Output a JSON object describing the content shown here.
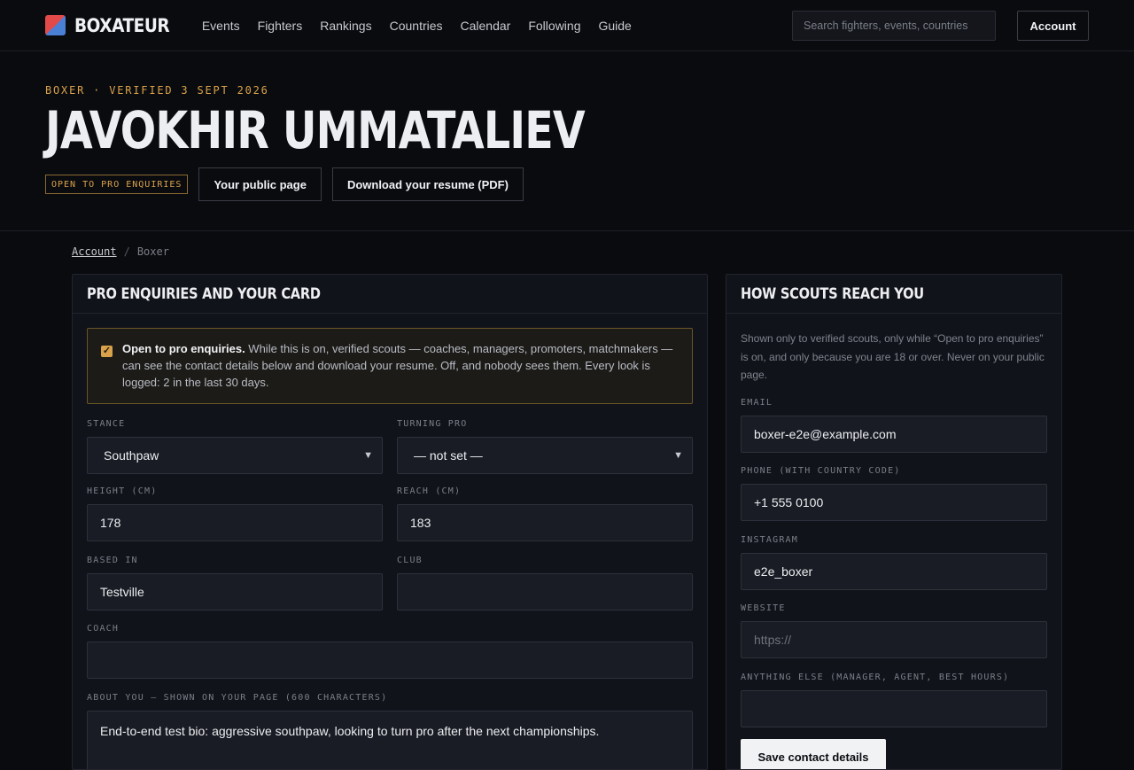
{
  "nav": {
    "brand": "BOXATEUR",
    "links": [
      "Events",
      "Fighters",
      "Rankings",
      "Countries",
      "Calendar",
      "Following",
      "Guide"
    ],
    "search_placeholder": "Search fighters, events, countries",
    "account_label": "Account"
  },
  "hero": {
    "eyebrow": "BOXER · VERIFIED 3 SEPT 2026",
    "name": "JAVOKHIR UMMATALIEV",
    "badge": "OPEN TO PRO ENQUIRIES",
    "public_page_label": "Your public page",
    "resume_label": "Download your resume (PDF)"
  },
  "breadcrumb": {
    "parent": "Account",
    "separator": "/",
    "current": "Boxer"
  },
  "left_panel": {
    "title": "PRO ENQUIRIES AND YOUR CARD",
    "notice": {
      "checked": true,
      "strong": "Open to pro enquiries.",
      "text": " While this is on, verified scouts — coaches, managers, promoters, matchmakers — can see the contact details below and download your resume. Off, and nobody sees them. Every look is logged: 2 in the last 30 days."
    },
    "fields": {
      "stance": {
        "label": "STANCE",
        "value": "Southpaw"
      },
      "turning_pro": {
        "label": "TURNING PRO",
        "value": "— not set —"
      },
      "height": {
        "label": "HEIGHT (CM)",
        "value": "178"
      },
      "reach": {
        "label": "REACH (CM)",
        "value": "183"
      },
      "based_in": {
        "label": "BASED IN",
        "value": "Testville"
      },
      "club": {
        "label": "CLUB",
        "value": ""
      },
      "coach": {
        "label": "COACH",
        "value": ""
      },
      "about": {
        "label": "ABOUT YOU — SHOWN ON YOUR PAGE (600 CHARACTERS)",
        "value": "End-to-end test bio: aggressive southpaw, looking to turn pro after the next championships."
      }
    }
  },
  "right_panel": {
    "title": "HOW SCOUTS REACH YOU",
    "description": "Shown only to verified scouts, only while “Open to pro enquiries” is on, and only because you are 18 or over. Never on your public page.",
    "fields": {
      "email": {
        "label": "EMAIL",
        "value": "boxer-e2e@example.com"
      },
      "phone": {
        "label": "PHONE (WITH COUNTRY CODE)",
        "value": "+1 555 0100"
      },
      "instagram": {
        "label": "INSTAGRAM",
        "value": "e2e_boxer"
      },
      "website": {
        "label": "WEBSITE",
        "value": "",
        "placeholder": "https://"
      },
      "other": {
        "label": "ANYTHING ELSE (MANAGER, AGENT, BEST HOURS)",
        "value": ""
      }
    },
    "save_label": "Save contact details"
  },
  "colors": {
    "background": "#0a0b0f",
    "panel": "#11131a",
    "accent_gold": "#d9a24a",
    "logo_red": "#e24a4a",
    "logo_blue": "#4a7fd6"
  }
}
